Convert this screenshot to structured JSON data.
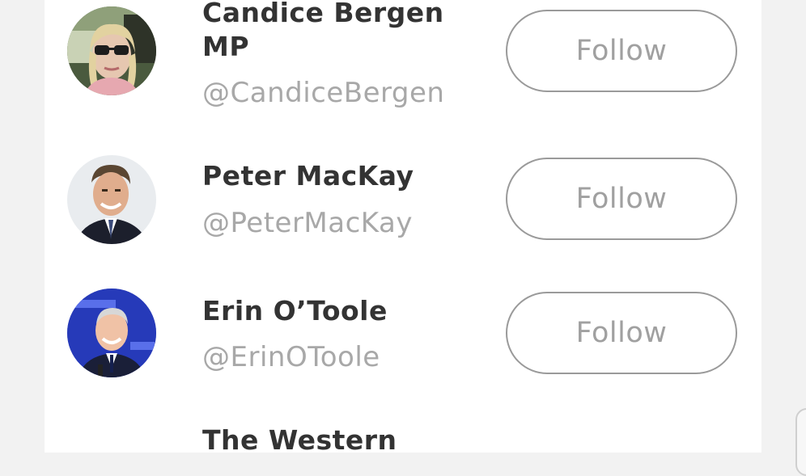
{
  "suggestions": [
    {
      "name_lines": [
        "Candice Bergen",
        "MP"
      ],
      "handle": "@CandiceBergen",
      "follow_label": "Follow",
      "avatar_icon": "person-photo-car"
    },
    {
      "name_lines": [
        "Peter MacKay"
      ],
      "handle": "@PeterMacKay",
      "follow_label": "Follow",
      "avatar_icon": "person-photo-suit"
    },
    {
      "name_lines": [
        "Erin O’Toole"
      ],
      "handle": "@ErinOToole",
      "follow_label": "Follow",
      "avatar_icon": "person-photo-stage"
    },
    {
      "name_lines": [
        "The Western"
      ]
    }
  ],
  "colors": {
    "background": "#f2f2f2",
    "panel": "#ffffff",
    "name_text": "#333333",
    "handle_text": "#a8a8a8",
    "button_border": "#9a9a9a",
    "button_text": "#a0a0a0"
  }
}
